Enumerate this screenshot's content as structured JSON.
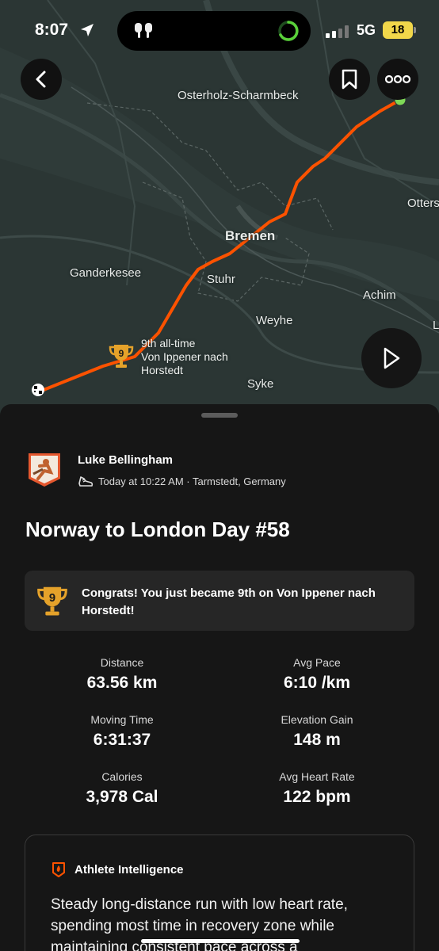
{
  "status_bar": {
    "time": "8:07",
    "network": "5G",
    "battery": "18"
  },
  "map": {
    "labels": {
      "osterholz": "Osterholz-Scharmbeck",
      "otters": "Otters",
      "bremen": "Bremen",
      "ganderkesee": "Ganderkesee",
      "stuhr": "Stuhr",
      "achim": "Achim",
      "weyhe": "Weyhe",
      "syke": "Syke",
      "edge_l": "L"
    },
    "segment_callout": {
      "rank": "9th all-time",
      "name_line1": "Von Ippener nach",
      "name_line2": "Horstedt"
    },
    "trophy_number": "9",
    "icons": {
      "back": "chevron-left-icon",
      "bookmark": "bookmark-icon",
      "more": "more-icon",
      "play": "play-icon"
    }
  },
  "activity": {
    "athlete_name": "Luke Bellingham",
    "meta": "Today at 10:22 AM · Tarmstedt, Germany",
    "title": "Norway to London Day #58",
    "congrats": "Congrats! You just became 9th on Von Ippener nach Horstedt!",
    "stats": [
      {
        "label": "Distance",
        "value": "63.56 km"
      },
      {
        "label": "Avg Pace",
        "value": "6:10 /km"
      },
      {
        "label": "Moving Time",
        "value": "6:31:37"
      },
      {
        "label": "Elevation Gain",
        "value": "148 m"
      },
      {
        "label": "Calories",
        "value": "3,978 Cal"
      },
      {
        "label": "Avg Heart Rate",
        "value": "122 bpm"
      }
    ],
    "intelligence": {
      "title": "Athlete Intelligence",
      "text": "Steady long-distance run with low heart rate, spending most time in recovery zone while maintaining consistent pace across a"
    }
  },
  "colors": {
    "route": "#fc5200",
    "map_bg": "#2b3634",
    "sheet_bg": "#161616",
    "trophy": "#e5a22a",
    "battery": "#f1d74a",
    "start_dot": "#7ed957"
  }
}
